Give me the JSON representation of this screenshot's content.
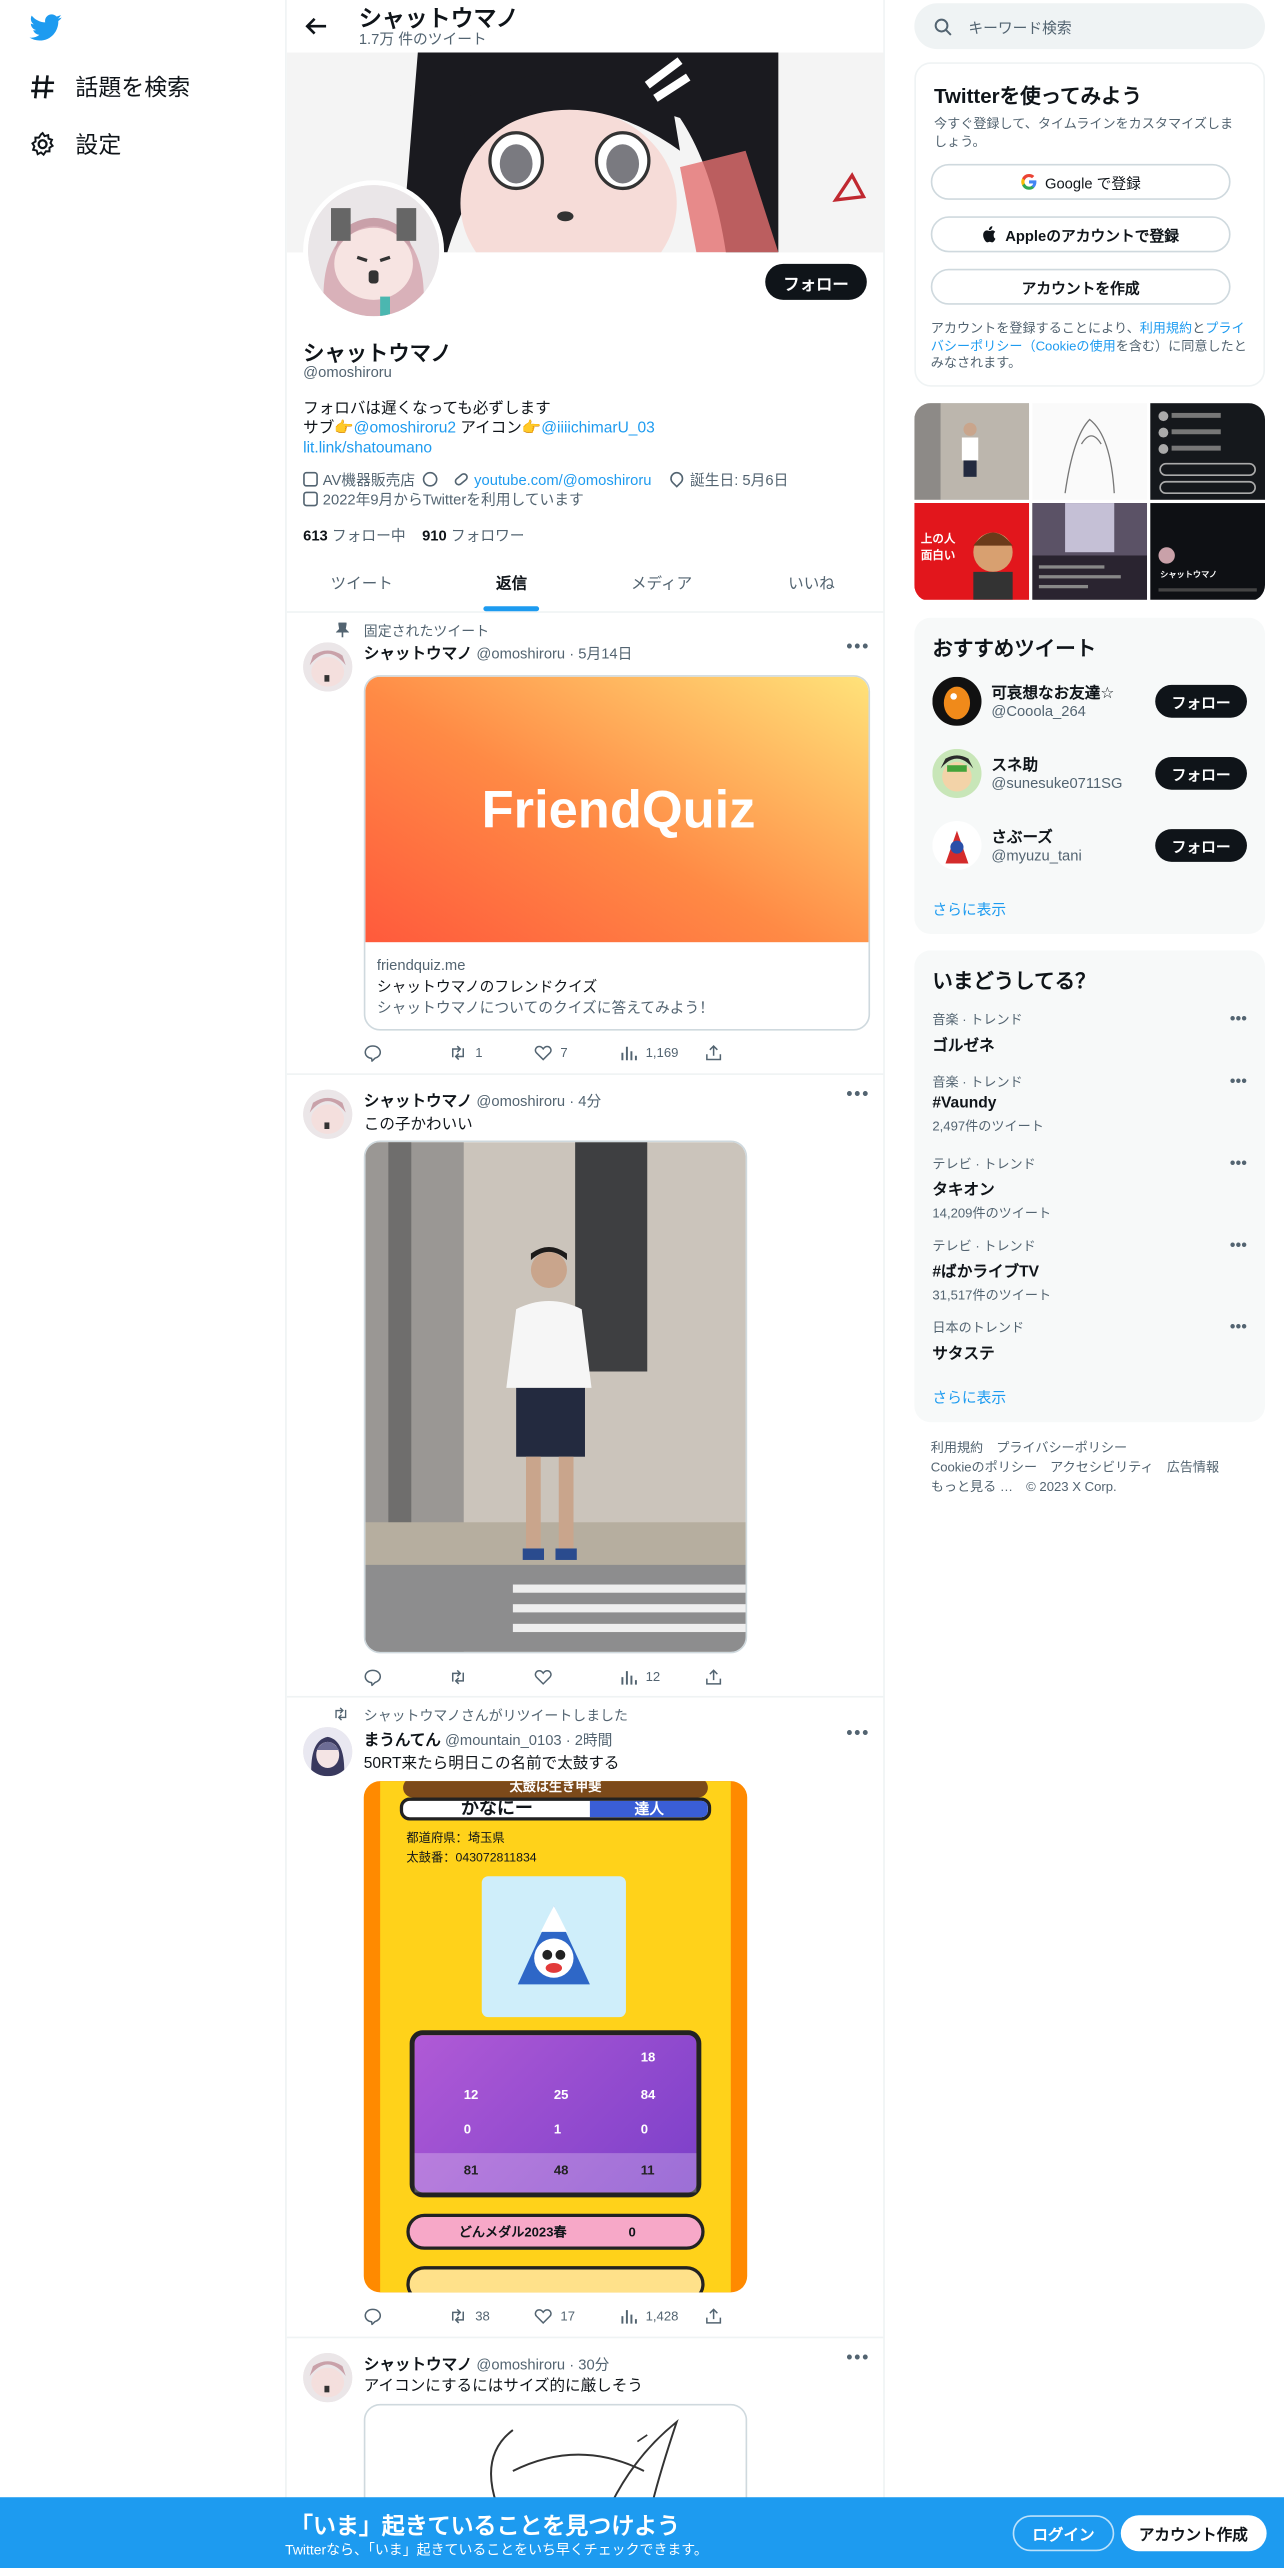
{
  "nav": {
    "explore_label": "話題を検索",
    "settings_label": "設定"
  },
  "header": {
    "title": "シャットウマノ",
    "tweet_count": "1.7万 件のツイート"
  },
  "profile": {
    "follow_label": "フォロー",
    "name": "シャットウマノ",
    "handle": "@omoshiroru",
    "bio_line1": "フォロバは遅くなっても必ずします",
    "bio_sub_prefix": "サブ👉",
    "bio_sub_link": "@omoshiroru2",
    "bio_icon_prefix": "アイコン👉",
    "bio_icon_link": "@iiiichimarU_03",
    "bio_link": "lit.link/shatoumano",
    "category": "AV機器販売店",
    "website": "youtube.com/@omoshiroru",
    "birthday": "誕生日: 5月6日",
    "joined": "2022年9月からTwitterを利用しています",
    "following_count": "613",
    "following_label": "フォロー中",
    "followers_count": "910",
    "followers_label": "フォロワー"
  },
  "tabs": [
    "ツイート",
    "返信",
    "メディア",
    "いいね"
  ],
  "tweets": [
    {
      "context": "固定されたツイート",
      "name": "シャットウマノ",
      "handle": "@omoshiroru · 5月14日",
      "card_title_img": "FriendQuiz",
      "card_domain": "friendquiz.me",
      "card_title": "シャットウマノのフレンドクイズ",
      "card_desc": "シャットウマノについてのクイズに答えてみよう！",
      "retweets": "1",
      "likes": "7",
      "views": "1,169"
    },
    {
      "name": "シャットウマノ",
      "handle": "@omoshiroru · 4分",
      "text": "この子かわいい",
      "views": "12"
    },
    {
      "context": "シャットウマノさんがリツイートしました",
      "name": "まうんてん",
      "handle": "@mountain_0103 · 2時間",
      "text": "50RT来たら明日この名前で太鼓する",
      "retweets": "38",
      "likes": "17",
      "views": "1,428",
      "game": {
        "banner": "太鼓は生き甲斐",
        "player": "かなにー",
        "rank": "達人",
        "pref": "都道府県：埼玉県",
        "id": "太鼓番：043072811834",
        "stats": [
          "18",
          "12",
          "25",
          "84",
          "0",
          "1",
          "0",
          "81",
          "48",
          "11"
        ],
        "medal": "どんメダル2023春",
        "medal_count": "0"
      }
    },
    {
      "name": "シャットウマノ",
      "handle": "@omoshiroru · 30分",
      "text": "アイコンにするにはサイズ的に厳しそう"
    }
  ],
  "sidebar": {
    "search_placeholder": "キーワード検索",
    "signup_title": "Twitterを使ってみよう",
    "signup_desc": "今すぐ登録して、タイムラインをカスタマイズしましょう。",
    "google_label": "Google で登録",
    "apple_label": "Appleのアカウントで登録",
    "create_label": "アカウントを作成",
    "terms_prefix": "アカウントを登録することにより、",
    "terms_link1": "利用規約",
    "terms_mid": "と",
    "terms_link2": "プライバシーポリシー（Cookieの使用",
    "terms_suffix": "を含む）に同意したとみなされます。",
    "media_name": "シャットウマノ",
    "rec_title": "おすすめツイート",
    "recs": [
      {
        "name": "可哀想なお友達☆",
        "handle": "@Cooola_264",
        "btn": "フォロー"
      },
      {
        "name": "スネ助",
        "handle": "@sunesuke0711SG",
        "btn": "フォロー"
      },
      {
        "name": "さぶーズ",
        "handle": "@myuzu_tani",
        "btn": "フォロー"
      }
    ],
    "show_more": "さらに表示",
    "trends_title": "いまどうしてる？",
    "trends": [
      {
        "cat": "音楽 · トレンド",
        "name": "ゴルゼネ",
        "count": ""
      },
      {
        "cat": "音楽 · トレンド",
        "name": "#Vaundy",
        "count": "2,497件のツイート"
      },
      {
        "cat": "テレビ · トレンド",
        "name": "タキオン",
        "count": "14,209件のツイート"
      },
      {
        "cat": "テレビ · トレンド",
        "name": "#ばかライブTV",
        "count": "31,517件のツイート"
      },
      {
        "cat": "日本のトレンド",
        "name": "サタステ",
        "count": ""
      }
    ],
    "footer1": "利用規約　プライバシーポリシー",
    "footer2": "Cookieのポリシー　アクセシビリティ　広告情報",
    "footer3": "もっと見る …　© 2023 X Corp."
  },
  "bottom_bar": {
    "title": "「いま」起きていることを見つけよう",
    "subtitle": "Twitterなら、「いま」起きていることをいち早くチェックできます。",
    "login": "ログイン",
    "signup": "アカウント作成"
  },
  "colors": {
    "accent": "#1d9bf0",
    "text": "#0f1419",
    "muted": "#536471"
  }
}
